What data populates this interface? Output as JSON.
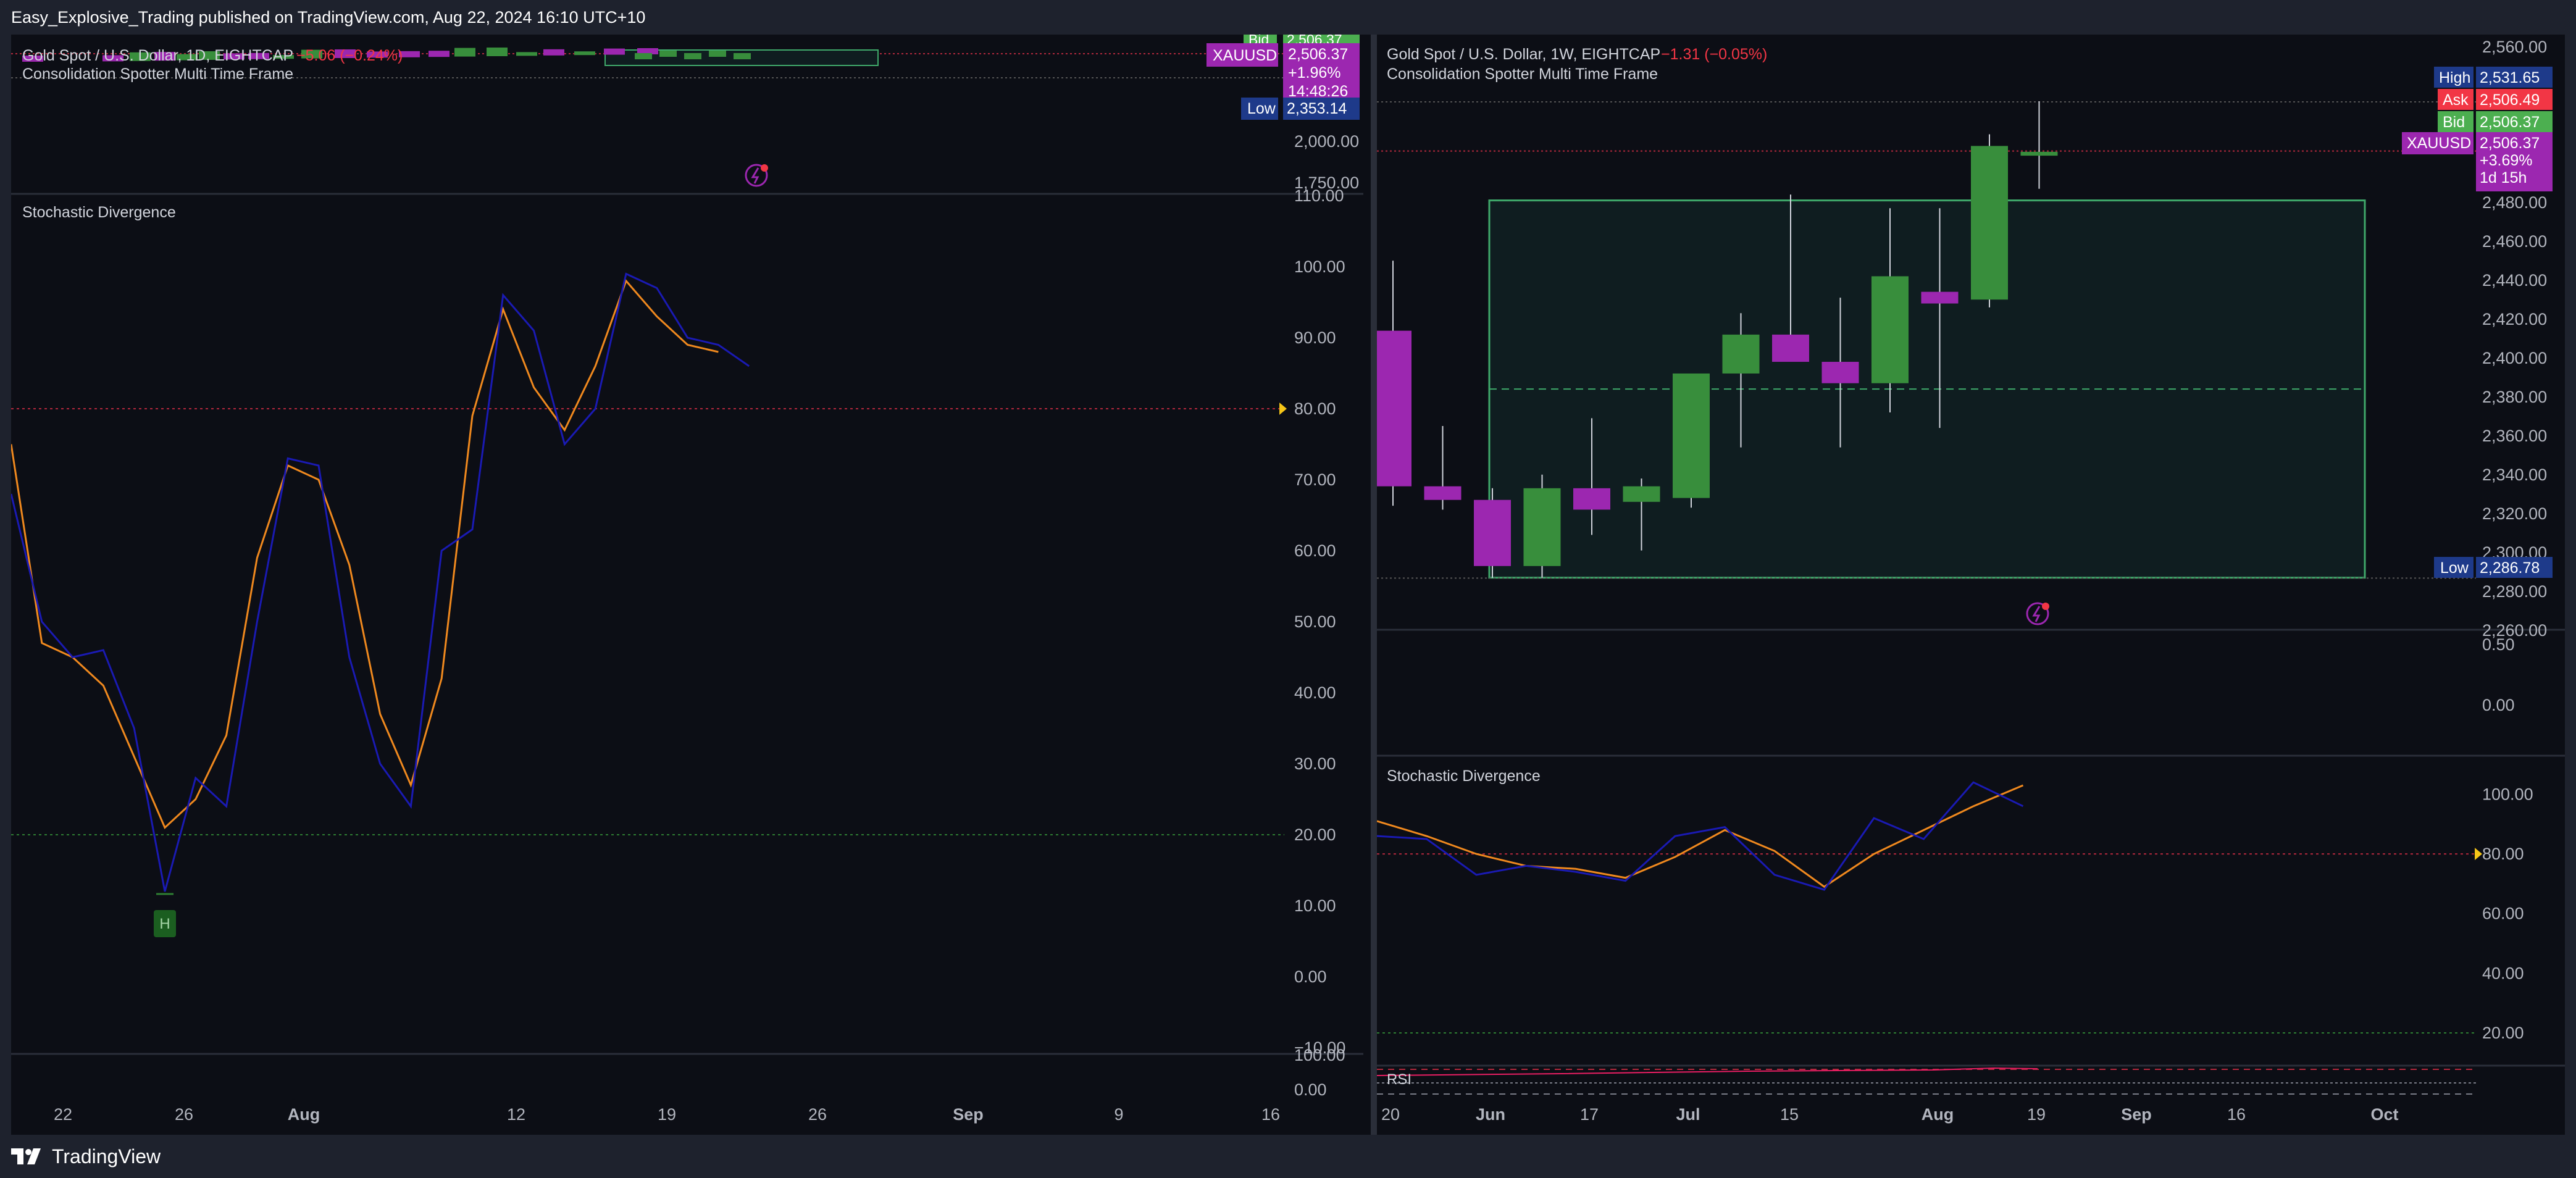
{
  "header": {
    "publisher_text": "Easy_Explosive_Trading published on TradingView.com, Aug 22, 2024 16:10 UTC+10"
  },
  "footer": {
    "brand": "TradingView"
  },
  "left_panel": {
    "price_pane": {
      "title": "Gold Spot / U.S. Dollar, 1D, EIGHTCAP",
      "change": "−5.06 (−0.24%)",
      "indicator": "Consolidation Spotter Multi Time Frame",
      "y_ticks": [
        "2,000.00",
        "1,750.00"
      ],
      "price_labels": [
        {
          "key": "bid",
          "tag": "Bid",
          "value": "2,506.37",
          "color": "#4caf50"
        },
        {
          "key": "symbol",
          "tag": "XAUUSD",
          "lines": [
            "2,506.37",
            "+1.96%",
            "14:48:26"
          ],
          "color": "#9c27b0"
        },
        {
          "key": "low",
          "tag": "Low",
          "value": "2,353.14",
          "color": "#1e3a8a"
        }
      ]
    },
    "osc_pane": {
      "title": "Stochastic Divergence",
      "y_ticks": [
        "110.00",
        "100.00",
        "90.00",
        "80.00",
        "70.00",
        "60.00",
        "50.00",
        "40.00",
        "30.00",
        "20.00",
        "10.00",
        "0.00",
        "−10.00"
      ],
      "marker_label": "H",
      "overbought": 80,
      "oversold": 20
    },
    "rsi_pane": {
      "y_ticks": [
        "100.00",
        "0.00"
      ]
    },
    "x_ticks": [
      "22",
      "26",
      "Aug",
      "12",
      "19",
      "26",
      "Sep",
      "9",
      "16"
    ]
  },
  "right_panel": {
    "price_pane": {
      "title": "Gold Spot / U.S. Dollar, 1W, EIGHTCAP",
      "change": "−1.31 (−0.05%)",
      "indicator": "Consolidation Spotter Multi Time Frame",
      "y_ticks": [
        "2,560.00",
        "2,480.00",
        "2,460.00",
        "2,440.00",
        "2,420.00",
        "2,400.00",
        "2,380.00",
        "2,360.00",
        "2,340.00",
        "2,320.00",
        "2,300.00",
        "2,280.00",
        "2,260.00"
      ],
      "price_labels": [
        {
          "key": "high",
          "tag": "High",
          "value": "2,531.65",
          "color": "#1e3a8a"
        },
        {
          "key": "ask",
          "tag": "Ask",
          "value": "2,506.49",
          "color": "#f23645"
        },
        {
          "key": "bid",
          "tag": "Bid",
          "value": "2,506.37",
          "color": "#4caf50"
        },
        {
          "key": "symbol",
          "tag": "XAUUSD",
          "lines": [
            "2,506.37",
            "+3.69%",
            "1d 15h"
          ],
          "color": "#9c27b0"
        },
        {
          "key": "low",
          "tag": "Low",
          "value": "2,286.78",
          "color": "#1e3a8a"
        }
      ]
    },
    "mid_pane": {
      "y_ticks": [
        "0.50",
        "0.00"
      ]
    },
    "osc_pane": {
      "title": "Stochastic Divergence",
      "y_ticks": [
        "100.00",
        "80.00",
        "60.00",
        "40.00",
        "20.00"
      ],
      "overbought": 80,
      "oversold": 20
    },
    "rsi_pane": {
      "label": "RSI"
    },
    "x_ticks": [
      "20",
      "Jun",
      "17",
      "Jul",
      "15",
      "Aug",
      "19",
      "Sep",
      "16",
      "Oct"
    ]
  },
  "colors": {
    "bg": "#0c0e15",
    "up": "#388e3c",
    "down": "#9c27b0",
    "k_line": "#1a1ab3",
    "d_line": "#f0891e",
    "level_red": "#b2283d",
    "box_border": "#3fa86a",
    "box_fill": "#0f1d20",
    "axis_text": "#b2b5be"
  },
  "chart_data": [
    {
      "type": "line",
      "title": "Stochastic Divergence",
      "timeframe": "1D",
      "x": [
        "Jul 19",
        "Jul 22",
        "Jul 23",
        "Jul 24",
        "Jul 25",
        "Jul 26",
        "Jul 29",
        "Jul 30",
        "Jul 31",
        "Aug 1",
        "Aug 2",
        "Aug 5",
        "Aug 6",
        "Aug 7",
        "Aug 8",
        "Aug 9",
        "Aug 12",
        "Aug 13",
        "Aug 14",
        "Aug 15",
        "Aug 16",
        "Aug 19",
        "Aug 20",
        "Aug 21",
        "Aug 22"
      ],
      "series": [
        {
          "name": "%K",
          "values": [
            68,
            50,
            45,
            46,
            35,
            12,
            28,
            24,
            50,
            73,
            72,
            45,
            30,
            24,
            60,
            63,
            96,
            91,
            75,
            80,
            99,
            97,
            90,
            89,
            86
          ]
        },
        {
          "name": "%D",
          "values": [
            75,
            47,
            45,
            41,
            31,
            21,
            25,
            34,
            59,
            72,
            70,
            58,
            37,
            27,
            42,
            79,
            94,
            83,
            77,
            86,
            98,
            93,
            89,
            88
          ]
        }
      ],
      "ylim": [
        -10,
        110
      ],
      "levels": [
        80,
        20
      ],
      "annotations": [
        "H"
      ]
    },
    {
      "type": "candlestick",
      "title": "Gold Spot / U.S. Dollar",
      "timeframe": "1W",
      "x": [
        "May 20",
        "May 27",
        "Jun 3",
        "Jun 10",
        "Jun 17",
        "Jun 24",
        "Jul 1",
        "Jul 8",
        "Jul 15",
        "Jul 22",
        "Jul 29",
        "Aug 5",
        "Aug 12",
        "Aug 19"
      ],
      "open": [
        2414,
        2334,
        2327,
        2293,
        2333,
        2326,
        2328,
        2392,
        2412,
        2398,
        2387,
        2434,
        2430,
        2504
      ],
      "high": [
        2450,
        2365,
        2333,
        2340,
        2369,
        2338,
        2392,
        2423,
        2484,
        2431,
        2477,
        2477,
        2515,
        2532
      ],
      "low": [
        2324,
        2322,
        2287,
        2287,
        2309,
        2301,
        2323,
        2354,
        2398,
        2354,
        2372,
        2364,
        2426,
        2487
      ],
      "close": [
        2334,
        2327,
        2293,
        2333,
        2322,
        2334,
        2392,
        2412,
        2398,
        2387,
        2442,
        2428,
        2509,
        2506
      ],
      "consolidation_box": {
        "top": 2481,
        "bottom": 2287,
        "mid": 2384
      },
      "ylim": [
        2250,
        2565
      ]
    },
    {
      "type": "line",
      "title": "Stochastic Divergence",
      "timeframe": "1W",
      "x": [
        "May 20",
        "May 27",
        "Jun 3",
        "Jun 10",
        "Jun 17",
        "Jun 24",
        "Jul 1",
        "Jul 8",
        "Jul 15",
        "Jul 22",
        "Jul 29",
        "Aug 5",
        "Aug 12",
        "Aug 19"
      ],
      "series": [
        {
          "name": "%K",
          "values": [
            86,
            85,
            73,
            76,
            74,
            71,
            86,
            89,
            73,
            68,
            92,
            85,
            104,
            96
          ]
        },
        {
          "name": "%D",
          "values": [
            91,
            86,
            80,
            76,
            75,
            72,
            79,
            88,
            81,
            69,
            80,
            88,
            96,
            103
          ]
        }
      ],
      "ylim": [
        12,
        108
      ],
      "levels": [
        80,
        20
      ]
    }
  ]
}
